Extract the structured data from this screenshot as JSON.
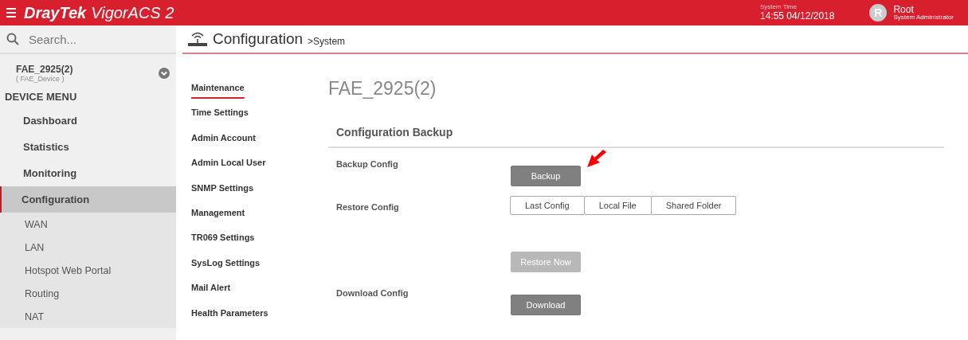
{
  "header": {
    "brand": "DrayTek",
    "product": "VigorACS 2",
    "system_time_label": "System Time",
    "system_time": "14:55 04/12/2018",
    "user": {
      "initial": "R",
      "name": "Root",
      "role": "System Administrator"
    }
  },
  "sidebar": {
    "search": {
      "placeholder": "Search..."
    },
    "device": {
      "name": "FAE_2925(2)",
      "group": "( FAE_Device )"
    },
    "menu_title": "DEVICE MENU",
    "items": [
      {
        "label": "Dashboard",
        "selected": false
      },
      {
        "label": "Statistics",
        "selected": false
      },
      {
        "label": "Monitoring",
        "selected": false
      },
      {
        "label": "Configuration",
        "selected": true,
        "children": [
          {
            "label": "WAN"
          },
          {
            "label": "LAN"
          },
          {
            "label": "Hotspot Web Portal"
          },
          {
            "label": "Routing"
          },
          {
            "label": "NAT"
          }
        ]
      }
    ]
  },
  "page": {
    "title": "Configuration",
    "crumb": ">System"
  },
  "submenu": [
    {
      "label": "Maintenance",
      "selected": true
    },
    {
      "label": "Time Settings",
      "selected": false
    },
    {
      "label": "Admin Account",
      "selected": false
    },
    {
      "label": "Admin Local User",
      "selected": false
    },
    {
      "label": "SNMP Settings",
      "selected": false
    },
    {
      "label": "Management",
      "selected": false
    },
    {
      "label": "TR069 Settings",
      "selected": false
    },
    {
      "label": "SysLog Settings",
      "selected": false
    },
    {
      "label": "Mail Alert",
      "selected": false
    },
    {
      "label": "Health Parameters",
      "selected": false
    }
  ],
  "device_title": "FAE_2925(2)",
  "section": {
    "title": "Configuration Backup",
    "rows": [
      {
        "kind": "button",
        "label": "Backup Config",
        "button": "Backup",
        "disabled": false
      },
      {
        "kind": "options",
        "label": "Restore Config",
        "options": [
          "Last Config",
          "Local File",
          "Shared Folder"
        ]
      },
      {
        "kind": "button",
        "label": "",
        "button": "Restore Now",
        "disabled": true
      },
      {
        "kind": "button",
        "label": "Download Config",
        "button": "Download",
        "disabled": false
      }
    ]
  }
}
